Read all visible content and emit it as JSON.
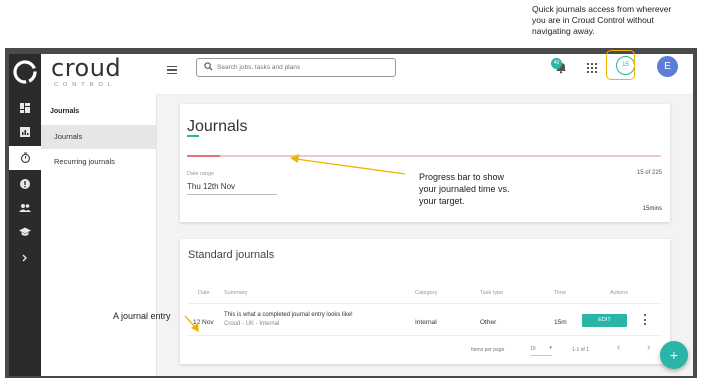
{
  "annotations": {
    "quick_access": [
      "Quick journals access from wherever",
      "you are in Croud Control without",
      "navigating away."
    ],
    "progress_bar": [
      "Progress bar to show",
      "your journaled time vs.",
      "your target."
    ],
    "journal_entry": "A journal entry"
  },
  "brand": {
    "name": "croud",
    "subtitle": "CONTROL"
  },
  "rail": {
    "icons": [
      "dashboard-icon",
      "reports-icon",
      "timer-icon",
      "info-icon",
      "people-icon",
      "learning-icon",
      "expand-icon"
    ],
    "active_index": 2
  },
  "subnav": {
    "heading": "Journals",
    "items": [
      {
        "label": "Journals",
        "active": true
      },
      {
        "label": "Recurring journals",
        "active": false
      }
    ]
  },
  "topbar": {
    "search_placeholder": "Search jobs, tasks and plans",
    "notification_count": "40",
    "timer_value": "15",
    "avatar_initial": "E"
  },
  "journals_card": {
    "title": "Journals",
    "progress": {
      "logged_minutes": 15,
      "target_minutes": 225,
      "label": "15 of 225",
      "fill_fraction": 0.07
    },
    "date_range_label": "Date range",
    "date_range_value": "Thu 12th Nov",
    "target_label": "15mins"
  },
  "standard_journals": {
    "title": "Standard journals",
    "columns": [
      "Date",
      "Summary",
      "Category",
      "Task type",
      "Time",
      "Actions"
    ],
    "rows": [
      {
        "date": "12 Nov",
        "summary": "This is what a completed journal entry looks like!",
        "summary_sub": "Croud - UK - Internal",
        "category": "Internal",
        "task_type": "Other",
        "time": "15m",
        "action_label": "EDIT"
      }
    ],
    "footer": {
      "items_per_page_label": "Items per page",
      "items_per_page_value": "10",
      "range": "1-1 of 1"
    }
  },
  "colors": {
    "accent": "#2bb5a6",
    "highlight": "#f0b400",
    "rail": "#2b2b2b",
    "progress_fill": "#e57373",
    "progress_track": "#f2c7c7"
  }
}
